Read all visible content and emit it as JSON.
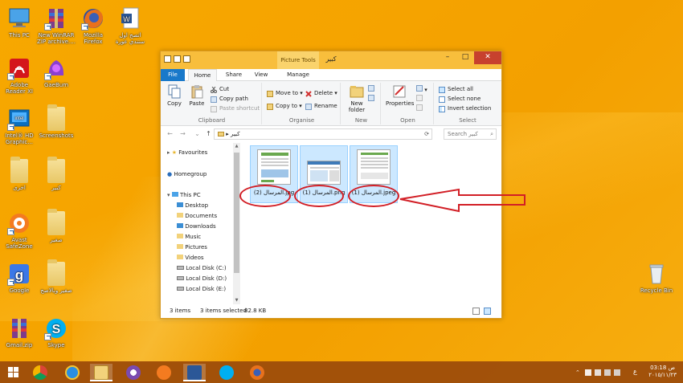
{
  "desktop": {
    "icons": [
      {
        "label": "This PC",
        "icon": "this-pc-icon"
      },
      {
        "label": "New WinRAR ZIP archive....",
        "icon": "winrar-icon"
      },
      {
        "label": "Mozilla Firefox",
        "icon": "firefox-icon"
      },
      {
        "label": "اتصح اول ستندي عورة",
        "icon": "word-document-icon"
      },
      {
        "label": "Adobe Reader XI",
        "icon": "adobe-reader-icon"
      },
      {
        "label": "GaeBum",
        "icon": "game-icon"
      },
      {
        "label": "Intel® HD Graphic...",
        "icon": "intel-graphics-icon"
      },
      {
        "label": "Screenshots",
        "icon": "folder-icon"
      },
      {
        "label": "اخرى",
        "icon": "folder-icon"
      },
      {
        "label": "كبير",
        "icon": "folder-icon"
      },
      {
        "label": "Avast SafeZone",
        "icon": "avast-icon"
      },
      {
        "label": "صغير",
        "icon": "folder-icon"
      },
      {
        "label": "Google",
        "icon": "google-icon"
      },
      {
        "label": "صغير وبالاصح",
        "icon": "folder-icon"
      },
      {
        "label": "Gmail.zip",
        "icon": "winrar-icon"
      },
      {
        "label": "Skype",
        "icon": "skype-icon"
      },
      {
        "label": "Recycle Bin",
        "icon": "recycle-bin-icon"
      }
    ]
  },
  "window": {
    "title": "كبير",
    "context_tab": "Picture Tools",
    "tabs": {
      "file": "File",
      "home": "Home",
      "share": "Share",
      "view": "View",
      "manage": "Manage"
    },
    "ribbon": {
      "copy": "Copy",
      "paste": "Paste",
      "cut": "Cut",
      "copy_path": "Copy path",
      "paste_shortcut": "Paste shortcut",
      "clipboard_label": "Clipboard",
      "move_to": "Move to",
      "copy_to": "Copy to",
      "delete": "Delete",
      "rename": "Rename",
      "organise_label": "Organise",
      "new_folder": "New folder",
      "new_label": "New",
      "properties": "Properties",
      "open_label": "Open",
      "select_all": "Select all",
      "select_none": "Select none",
      "invert_selection": "Invert selection",
      "select_label": "Select"
    },
    "address": {
      "path": "كبير"
    },
    "search": {
      "placeholder": "Search كبير"
    },
    "nav": {
      "favourites": "Favourites",
      "homegroup": "Homegroup",
      "this_pc": "This PC",
      "desktop": "Desktop",
      "documents": "Documents",
      "downloads": "Downloads",
      "music": "Music",
      "pictures": "Pictures",
      "videos": "Videos",
      "local_c": "Local Disk (C:)",
      "local_d": "Local Disk (D:)",
      "local_e": "Local Disk (E:)"
    },
    "files": [
      {
        "name": "المرسال (2).jpg"
      },
      {
        "name": "المرسال (1).png"
      },
      {
        "name": "المرسال (1).jpeg"
      }
    ],
    "status": {
      "count": "3 items",
      "selected": "3 items selected",
      "size": "82.8 KB"
    }
  },
  "taskbar": {
    "time": "03:18 ص",
    "date": "٢٠١٥/١١/٢٣",
    "lang": "ع"
  },
  "colors": {
    "desktop": "#f5a300",
    "titlebar": "#f8be3c",
    "file_tab": "#1979ca",
    "selection": "#cce8ff",
    "annotation": "#d21f26",
    "taskbar": "#96460a"
  }
}
